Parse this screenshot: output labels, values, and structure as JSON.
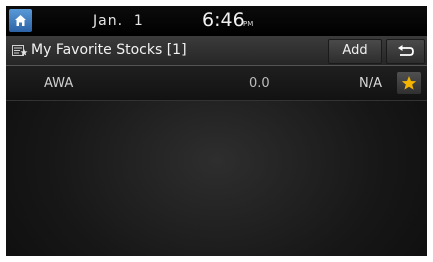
{
  "status_bar": {
    "date": "Jan.  1",
    "time": "6:46",
    "ampm": "PM"
  },
  "header": {
    "title": "My Favorite Stocks [1]",
    "add_label": "Add",
    "back_icon": "back-arrow-icon"
  },
  "stocks": [
    {
      "symbol": "AWA",
      "price": "0.0",
      "change": "N/A",
      "favorite": true
    }
  ],
  "colors": {
    "home_button": "#3a78c2",
    "star": "#f4b400",
    "background": "#141414"
  }
}
